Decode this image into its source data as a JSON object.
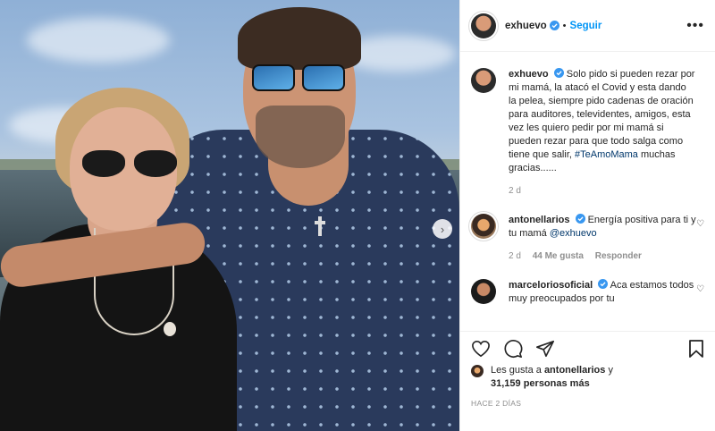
{
  "post": {
    "author": {
      "username": "exhuevo",
      "follow_label": "Seguir",
      "separator": "•",
      "more_icon": "more-horizontal-icon"
    },
    "caption": {
      "username": "exhuevo",
      "text": "Solo pido si pueden rezar por mi mamá, la atacó el Covid y esta dando la pelea, siempre pido cadenas de oración para auditores, televidentes, amigos, esta vez les quiero pedir por mi mamá si pueden rezar para que todo salga como tiene que salir,",
      "hashtag": "#TeAmoMama",
      "text_after": "muchas gracias......",
      "age": "2 d"
    },
    "comments": [
      {
        "username": "antonellarios",
        "text": "Energía positiva para ti y tu mamá",
        "mention": "@exhuevo",
        "age": "2 d",
        "likes": "44 Me gusta",
        "reply_label": "Responder"
      },
      {
        "username": "marceloriosoficial",
        "text": "Aca estamos todos muy preocupados por tu",
        "mention": "",
        "age": "",
        "likes": "",
        "reply_label": ""
      }
    ],
    "likes": {
      "prefix": "Les gusta a",
      "liker": "antonellarios",
      "conj": "y",
      "count": "31,159 personas más"
    },
    "timestamp": "HACE 2 DÍAS",
    "colors": {
      "link": "#0095f6",
      "hashtag": "#00376b",
      "verified": "#3897f0",
      "muted": "#8e8e8e"
    }
  }
}
